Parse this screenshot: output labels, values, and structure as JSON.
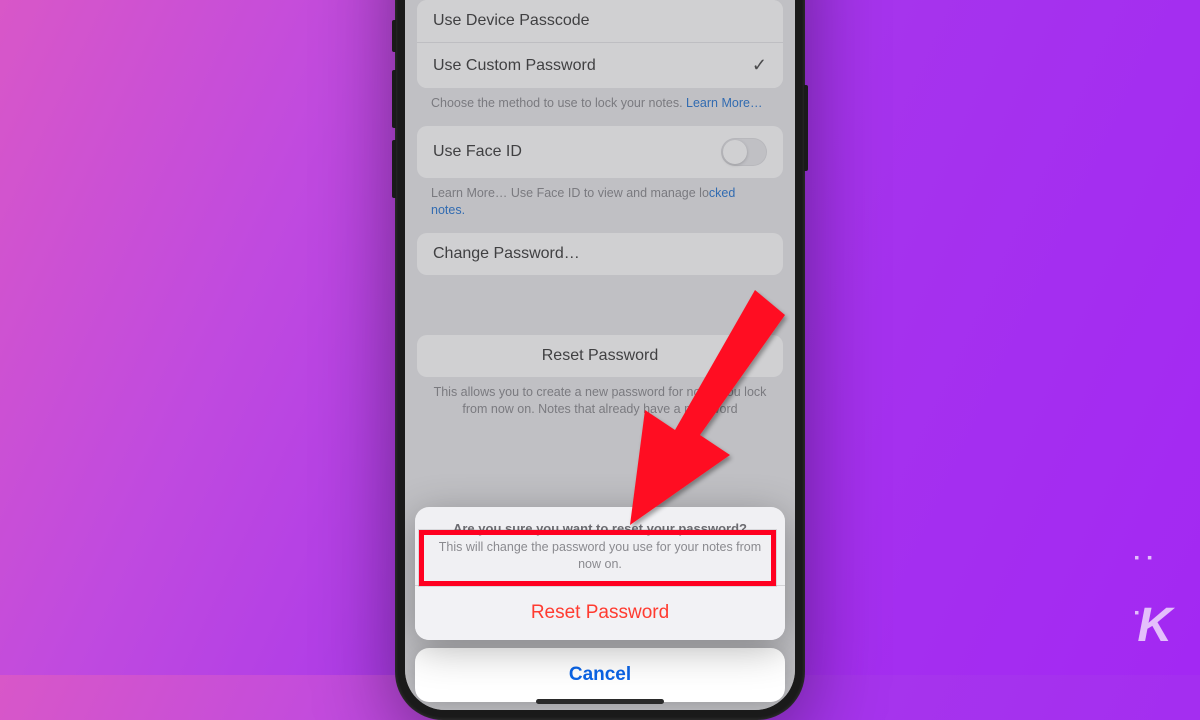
{
  "list": {
    "useDevicePasscode": "Use Device Passcode",
    "useCustomPassword": "Use Custom Password",
    "lockFootnote": "Choose the method to use to lock your notes. ",
    "learnMore": "Learn More…",
    "useFaceID": "Use Face ID",
    "faceIDFootnote1": "Learn More… Use Face ID to view and manage lo",
    "faceIDFootnote2": "cked notes.",
    "changePassword": "Change Password…",
    "resetPassword": "Reset Password",
    "resetFootnote": "This allows you to create a new password for notes you lock from now on. Notes that already have a password"
  },
  "sheet": {
    "title": "Are you sure you want to reset your password?",
    "sub": "This will change the password you use for your notes from now on.",
    "reset": "Reset Password",
    "cancel": "Cancel"
  }
}
